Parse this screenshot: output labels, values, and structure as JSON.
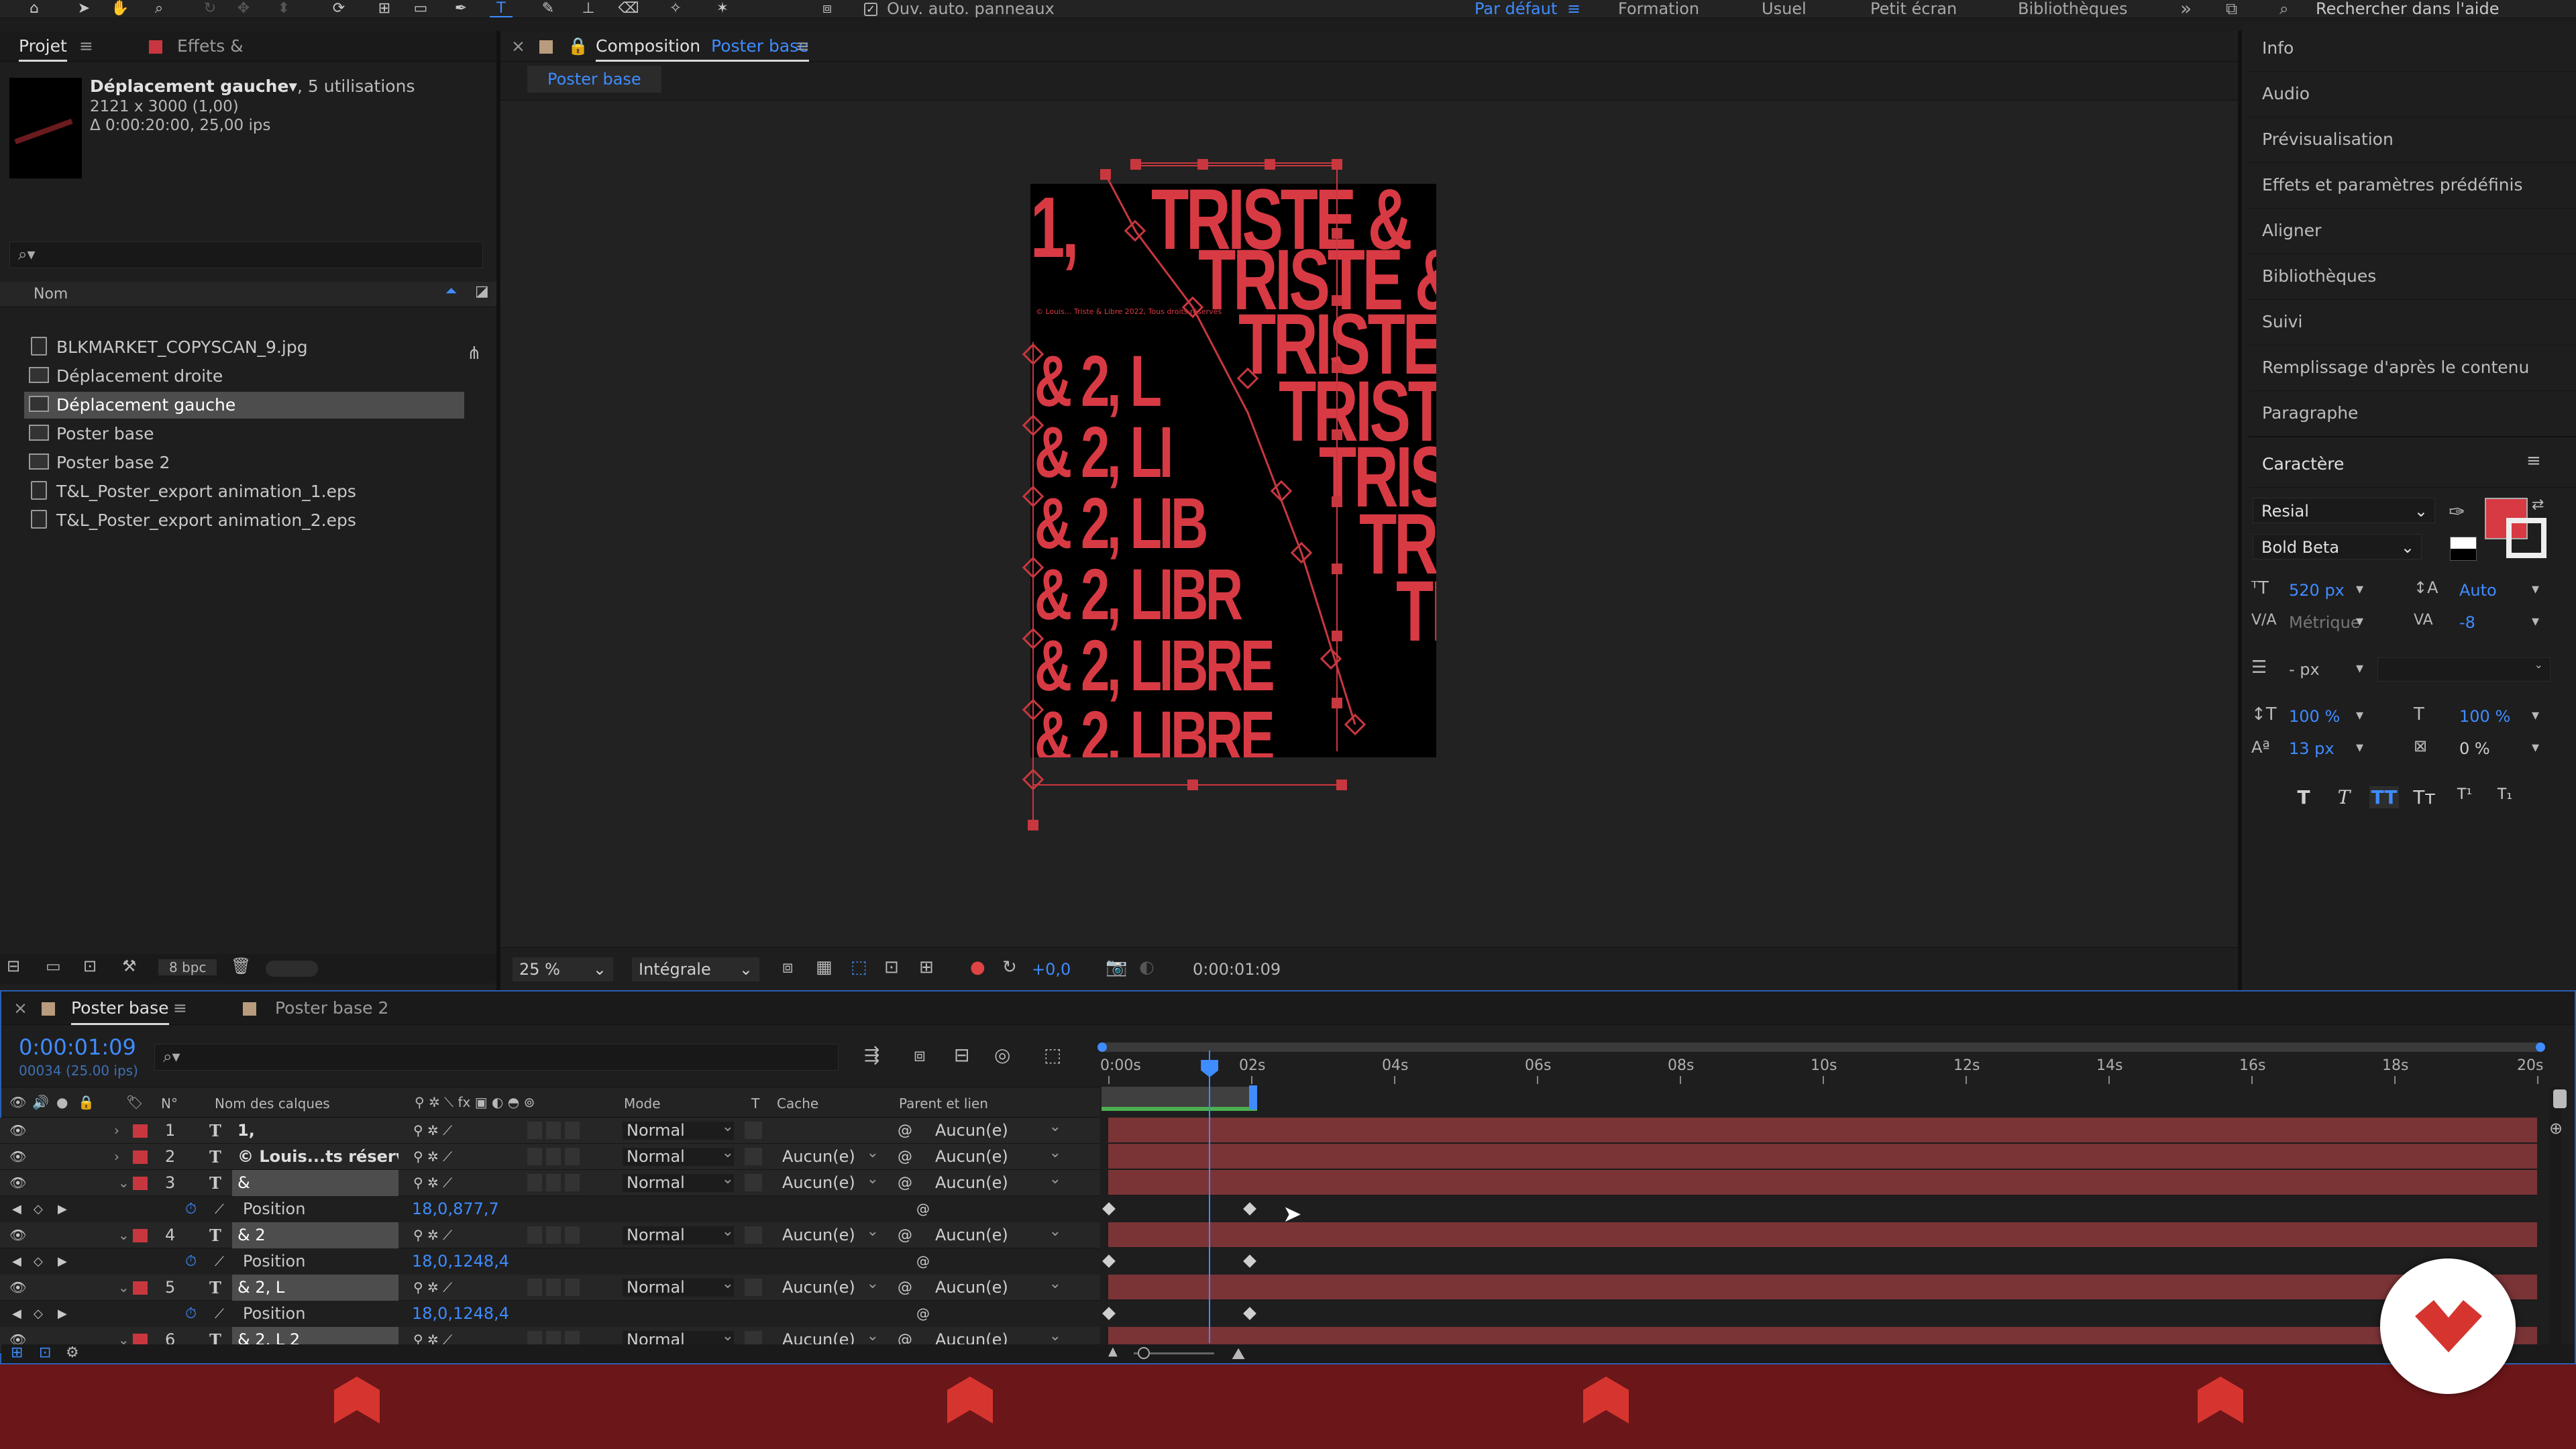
{
  "toolbar": {
    "auto_panels": "Ouv. auto. panneaux",
    "workspaces": [
      "Par défaut",
      "Formation",
      "Usuel",
      "Petit écran",
      "Bibliothèques"
    ],
    "active_workspace": "Par défaut",
    "search_help": "Rechercher dans l'aide"
  },
  "project": {
    "tab_project": "Projet",
    "tab_effects": "Effets &",
    "item_name": "Déplacement gauche",
    "usage": ", 5 utilisations",
    "dims": "2121 x 3000 (1,00)",
    "duration": "Δ 0:00:20:00, 25,00 ips",
    "col_name": "Nom",
    "items": [
      {
        "name": "BLKMARKET_COPYSCAN_9.jpg",
        "type": "file",
        "selected": false
      },
      {
        "name": "Déplacement droite",
        "type": "comp",
        "selected": false
      },
      {
        "name": "Déplacement gauche",
        "type": "comp",
        "selected": true
      },
      {
        "name": "Poster base",
        "type": "comp",
        "selected": false
      },
      {
        "name": "Poster base 2",
        "type": "comp",
        "selected": false
      },
      {
        "name": "T&L_Poster_export animation_1.eps",
        "type": "file",
        "selected": false
      },
      {
        "name": "T&L_Poster_export animation_2.eps",
        "type": "file",
        "selected": false
      }
    ],
    "bpc": "8 bpc"
  },
  "composition": {
    "label": "Composition",
    "name": "Poster base",
    "sub_tab": "Poster base",
    "zoom": "25 %",
    "resolution": "Intégrale",
    "exposure": "+0,0",
    "timecode": "0:00:01:09",
    "poster": {
      "lines": [
        "1,",
        "TRISTE &",
        "TRISTE &",
        "TRISTE",
        "TRISTE",
        "TRISTE",
        "TRISTE",
        "TRISTE"
      ],
      "left_lines": [
        "& 2, L",
        "& 2, LI",
        "& 2, LIB",
        "& 2, LIBR",
        "& 2, LIBRE",
        "& 2, LIBRE",
        "& 2, LIBRE"
      ],
      "fineprint": "© Louis... Triste & Libre 2022, Tous droits réservés",
      "accent": "#d83a44"
    }
  },
  "right_panel": {
    "items": [
      "Info",
      "Audio",
      "Prévisualisation",
      "Effets et paramètres prédéfinis",
      "Aligner",
      "Bibliothèques",
      "Suivi",
      "Remplissage d'après le contenu",
      "Paragraphe"
    ],
    "caractere_title": "Caractère",
    "font": "Resial",
    "style": "Bold Beta",
    "fill_color": "#d83a44",
    "size": "520 px",
    "leading": "Auto",
    "kerning": "Métrique",
    "tracking": "-8",
    "stroke": "- px",
    "vscale": "100 %",
    "hscale": "100 %",
    "baseline": "13 px",
    "tsume": "0 %",
    "style_buttons": [
      "T",
      "T",
      "TT",
      "Tт",
      "T¹",
      "T₁"
    ]
  },
  "timeline": {
    "tabs": [
      "Poster base",
      "Poster base 2"
    ],
    "timecode": "0:00:01:09",
    "frames": "00034 (25.00 ips)",
    "headers": {
      "num": "N°",
      "name": "Nom des calques",
      "mode": "Mode",
      "t": "T",
      "cache": "Cache",
      "parent": "Parent et lien"
    },
    "ruler": [
      "0:00s",
      "02s",
      "04s",
      "06s",
      "08s",
      "10s",
      "12s",
      "14s",
      "16s",
      "18s",
      "20s"
    ],
    "layers": [
      {
        "num": "1",
        "name": "1,",
        "mode": "Normal",
        "cache": "",
        "parent": "Aucun(e)",
        "expanded": false
      },
      {
        "num": "2",
        "name": "© Louis...ts réservés",
        "mode": "Normal",
        "cache": "Aucun(e)",
        "parent": "Aucun(e)",
        "expanded": false
      },
      {
        "num": "3",
        "name": "&",
        "mode": "Normal",
        "cache": "Aucun(e)",
        "parent": "Aucun(e)",
        "expanded": true,
        "position": "18,0,877,7"
      },
      {
        "num": "4",
        "name": "& 2",
        "mode": "Normal",
        "cache": "Aucun(e)",
        "parent": "Aucun(e)",
        "expanded": true,
        "position": "18,0,1248,4"
      },
      {
        "num": "5",
        "name": "& 2, L",
        "mode": "Normal",
        "cache": "Aucun(e)",
        "parent": "Aucun(e)",
        "expanded": true,
        "position": "18,0,1248,4"
      },
      {
        "num": "6",
        "name": "& 2, L 2",
        "mode": "Normal",
        "cache": "Aucun(e)",
        "parent": "Aucun(e)",
        "expanded": true
      }
    ],
    "position_label": "Position",
    "playhead_fraction": 0.0705
  }
}
